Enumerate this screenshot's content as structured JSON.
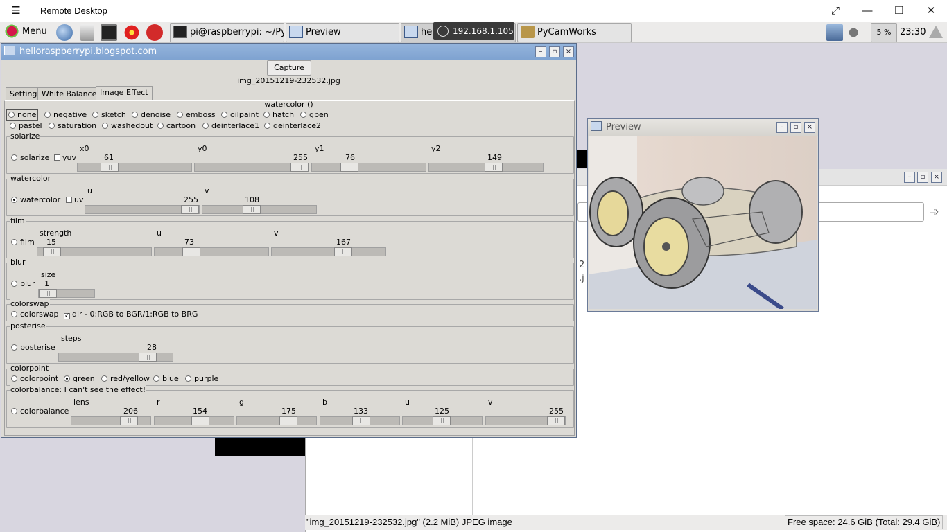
{
  "remote_desktop": {
    "title": "Remote Desktop"
  },
  "panel": {
    "menu_label": "Menu",
    "tasks": [
      {
        "label": "pi@raspberrypi: ~/Py..."
      },
      {
        "label": "Preview"
      },
      {
        "label": "hel..."
      },
      {
        "label": "PyCamWorks"
      }
    ],
    "ip_overlay": "192.168.1.105",
    "cpu": "5 %",
    "clock": "23:30"
  },
  "main_window": {
    "title": "helloraspberrypi.blogspot.com",
    "capture_label": "Capture",
    "filename": "img_20151219-232532.jpg",
    "tabs": [
      "Setting",
      "White Balance",
      "Image Effect"
    ],
    "current_effect": "watercolor ()",
    "effects_row1": [
      "none",
      "negative",
      "sketch",
      "denoise",
      "emboss",
      "oilpaint",
      "hatch",
      "gpen"
    ],
    "effects_row2": [
      "pastel",
      "saturation",
      "washedout",
      "cartoon",
      "deinterlace1",
      "deinterlace2"
    ],
    "solarize": {
      "frame": "solarize",
      "radio": "solarize",
      "check": "yuv",
      "sliders": [
        {
          "label": "x0",
          "value": "61",
          "pos": 0.24
        },
        {
          "label": "y0",
          "value": "255",
          "pos": 1.0
        },
        {
          "label": "y1",
          "value": "76",
          "pos": 0.3
        },
        {
          "label": "y2",
          "value": "149",
          "pos": 0.58
        }
      ]
    },
    "watercolor": {
      "frame": "watercolor",
      "radio": "watercolor",
      "check": "uv",
      "sliders": [
        {
          "label": "u",
          "value": "255",
          "pos": 1.0
        },
        {
          "label": "v",
          "value": "108",
          "pos": 0.42
        }
      ]
    },
    "film": {
      "frame": "film",
      "radio": "film",
      "sliders": [
        {
          "label": "strength",
          "value": "15",
          "pos": 0.06
        },
        {
          "label": "u",
          "value": "73",
          "pos": 0.29
        },
        {
          "label": "v",
          "value": "167",
          "pos": 0.65
        }
      ]
    },
    "blur": {
      "frame": "blur",
      "radio": "blur",
      "slider": {
        "label": "size",
        "value": "1",
        "pos": 0.0
      }
    },
    "colorswap": {
      "frame": "colorswap",
      "radio": "colorswap",
      "check": "dir - 0:RGB to BGR/1:RGB to BRG"
    },
    "posterise": {
      "frame": "posterise",
      "radio": "posterise",
      "slider": {
        "label": "steps",
        "value": "28",
        "pos": 0.83
      }
    },
    "colorpoint": {
      "frame": "colorpoint",
      "radio": "colorpoint",
      "options": [
        "green",
        "red/yellow",
        "blue",
        "purple"
      ]
    },
    "colorbalance": {
      "frame": "colorbalance: I can't see the effect!",
      "radio": "colorbalance",
      "sliders": [
        {
          "label": "lens",
          "value": "206",
          "pos": 0.8
        },
        {
          "label": "r",
          "value": "154",
          "pos": 0.6
        },
        {
          "label": "g",
          "value": "175",
          "pos": 0.69
        },
        {
          "label": "b",
          "value": "133",
          "pos": 0.52
        },
        {
          "label": "u",
          "value": "125",
          "pos": 0.49
        },
        {
          "label": "v",
          "value": "255",
          "pos": 1.0
        }
      ]
    }
  },
  "preview_window": {
    "title": "Preview"
  },
  "file_manager": {
    "status": "\"img_20151219-232532.jpg\" (2.2 MiB) JPEG image",
    "free_space": "Free space: 24.6 GiB (Total: 29.4 GiB)",
    "partial_text": [
      "2",
      ".j"
    ]
  }
}
